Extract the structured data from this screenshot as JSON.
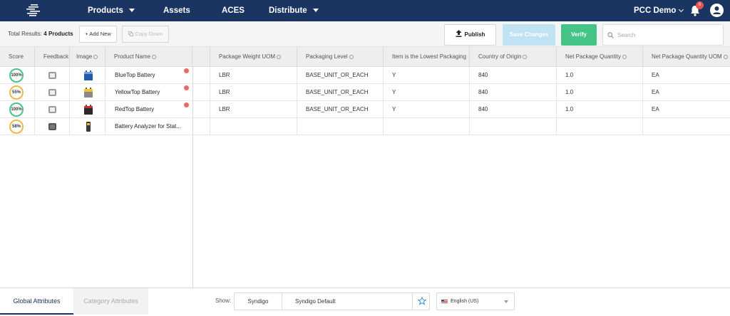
{
  "nav": {
    "items": [
      {
        "label": "Products",
        "dropdown": true
      },
      {
        "label": "Assets",
        "dropdown": false
      },
      {
        "label": "ACES",
        "dropdown": false
      },
      {
        "label": "Distribute",
        "dropdown": true
      }
    ],
    "user_label": "PCC Demo",
    "notification_count": "6",
    "bg_color": "#1b3563"
  },
  "toolbar": {
    "total_prefix": "Total Results:",
    "total_value": "4 Products",
    "add_new": "+ Add New",
    "copy_down": "Copy Down",
    "publish": "Publish",
    "save_changes": "Save Changes",
    "verify": "Verify",
    "search_placeholder": "Search"
  },
  "grid": {
    "fixed_headers": [
      "Score",
      "Feedback",
      "Image",
      "Product Name"
    ],
    "headers": [
      "Package Weight UOM",
      "Packaging Level",
      "Item is the Lowest Packaging",
      "Country of Origin",
      "Net Package Quantity",
      "Net Package Quantity UOM"
    ],
    "rows": [
      {
        "score": "100%",
        "score_level": "high",
        "name": "BlueTop Battery",
        "image": "battery-blue-icon",
        "alert": true,
        "feedback_dark": false,
        "values": [
          "LBR",
          "BASE_UNIT_OR_EACH",
          "Y",
          "840",
          "1.0",
          "EA"
        ]
      },
      {
        "score": "55%",
        "score_level": "med",
        "name": "YellowTop Battery",
        "image": "battery-yellow-icon",
        "alert": true,
        "feedback_dark": false,
        "values": [
          "LBR",
          "BASE_UNIT_OR_EACH",
          "Y",
          "840",
          "1.0",
          "EA"
        ]
      },
      {
        "score": "100%",
        "score_level": "high",
        "name": "RedTop Battery",
        "image": "battery-red-icon",
        "alert": true,
        "feedback_dark": false,
        "values": [
          "LBR",
          "BASE_UNIT_OR_EACH",
          "Y",
          "840",
          "1.0",
          "EA"
        ]
      },
      {
        "score": "58%",
        "score_level": "med",
        "name": "Battery Analyzer for Stat...",
        "image": "analyzer-icon",
        "alert": false,
        "feedback_dark": true,
        "values": [
          "",
          "",
          "",
          "",
          "",
          ""
        ]
      }
    ]
  },
  "bottom": {
    "tab_global": "Global Attributes",
    "tab_category": "Category Attributes",
    "show_label": "Show:",
    "show_source": "Syndigo",
    "show_view": "Syndigo Default",
    "language": "English (US)"
  },
  "colors": {
    "score_high": "#4cc38a",
    "score_med": "#f2b74a",
    "verify": "#44c486",
    "save_disabled": "#bfe3f3",
    "alert": "#e56b6b"
  }
}
